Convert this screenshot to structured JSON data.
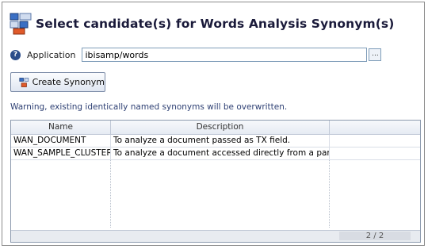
{
  "title": "Select candidate(s) for Words Analysis Synonym(s)",
  "application": {
    "label": "Application",
    "value": "ibisamp/words",
    "browse_label": "..."
  },
  "create_button": {
    "label": "Create Synonym"
  },
  "warning": "Warning, existing identically named synonyms will be overwritten.",
  "grid": {
    "columns": [
      "Name",
      "Description"
    ],
    "rows": [
      {
        "name": "WAN_DOCUMENT",
        "description": "To analyze a document passed as TX field."
      },
      {
        "name": "WAN_SAMPLE_CLUSTER",
        "description": "To analyze a document accessed directly from a parent."
      }
    ],
    "pager": "2 / 2"
  },
  "icons": {
    "title": "synonym-tree-icon",
    "help": "help-icon",
    "create": "create-synonym-icon"
  },
  "colors": {
    "title": "#1a1a3a",
    "warning": "#2d3f73",
    "help": "#2a4c8a"
  }
}
